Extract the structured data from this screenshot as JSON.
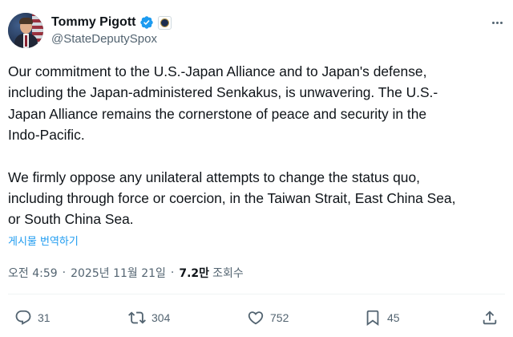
{
  "author": {
    "display_name": "Tommy Pigott",
    "handle": "@StateDeputySpox",
    "verified_icon": "verified-badge-icon",
    "affiliate_icon": "state-department-seal-icon",
    "avatar_icon": "profile-photo"
  },
  "tweet": {
    "paragraphs": [
      [
        "Our commitment to the U.S.-Japan Alliance and to Japan's defense,",
        "including the Japan-administered Senkakus, is unwavering. The U.S.-",
        "Japan Alliance remains the cornerstone of peace and security in the",
        "Indo-Pacific."
      ],
      [
        "We firmly oppose any unilateral attempts to change the status quo,",
        "including through force or coercion, in the Taiwan Strait, East China Sea,",
        "or South China Sea."
      ]
    ],
    "translate_label": "게시물 번역하기"
  },
  "meta": {
    "time": "오전 4:59",
    "separator": "·",
    "date": "2025년 11월 21일",
    "views_count": "7.2만",
    "views_label": "조회수"
  },
  "actions": {
    "reply_count": "31",
    "retweet_count": "304",
    "like_count": "752",
    "bookmark_count": "45"
  },
  "colors": {
    "text": "#0f1419",
    "secondary": "#536471",
    "link": "#1d9bf0",
    "verified": "#1d9bf0",
    "divider": "#eff3f4"
  }
}
